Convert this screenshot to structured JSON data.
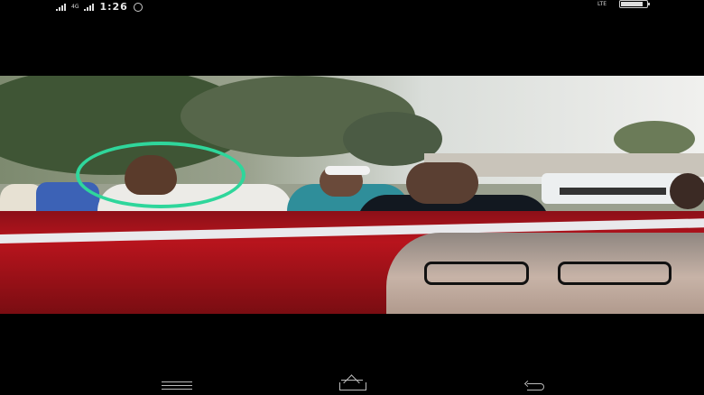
{
  "status_bar": {
    "network_left": "4G",
    "time": "1:26",
    "network_right": "LTE",
    "battery_level": 0.85
  },
  "photo": {
    "annotation_color": "#2fd69b",
    "banner_color": "#b8141d"
  },
  "nav_bar": {
    "icons": [
      "menu-icon",
      "home-icon",
      "back-icon"
    ]
  }
}
